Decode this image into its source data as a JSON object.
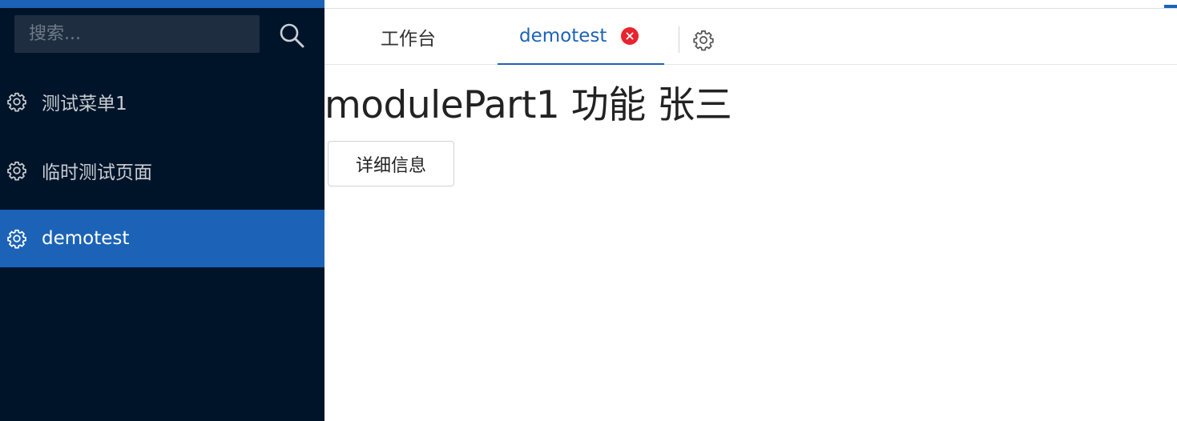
{
  "sidebar": {
    "search": {
      "placeholder": "搜索..."
    },
    "items": [
      {
        "label": "测试菜单1",
        "icon": "gear-icon",
        "active": false
      },
      {
        "label": "临时测试页面",
        "icon": "gear-icon",
        "active": false
      },
      {
        "label": "demotest",
        "icon": "gear-icon",
        "active": true
      }
    ]
  },
  "tabs": {
    "items": [
      {
        "label": "工作台",
        "active": false
      },
      {
        "label": "demotest",
        "active": true,
        "closable": true
      }
    ]
  },
  "main": {
    "title": "modulePart1 功能 张三",
    "detail_button": "详细信息"
  },
  "colors": {
    "sidebar_bg": "#001429",
    "accent": "#1c63b7",
    "close_badge": "#e8242f"
  }
}
